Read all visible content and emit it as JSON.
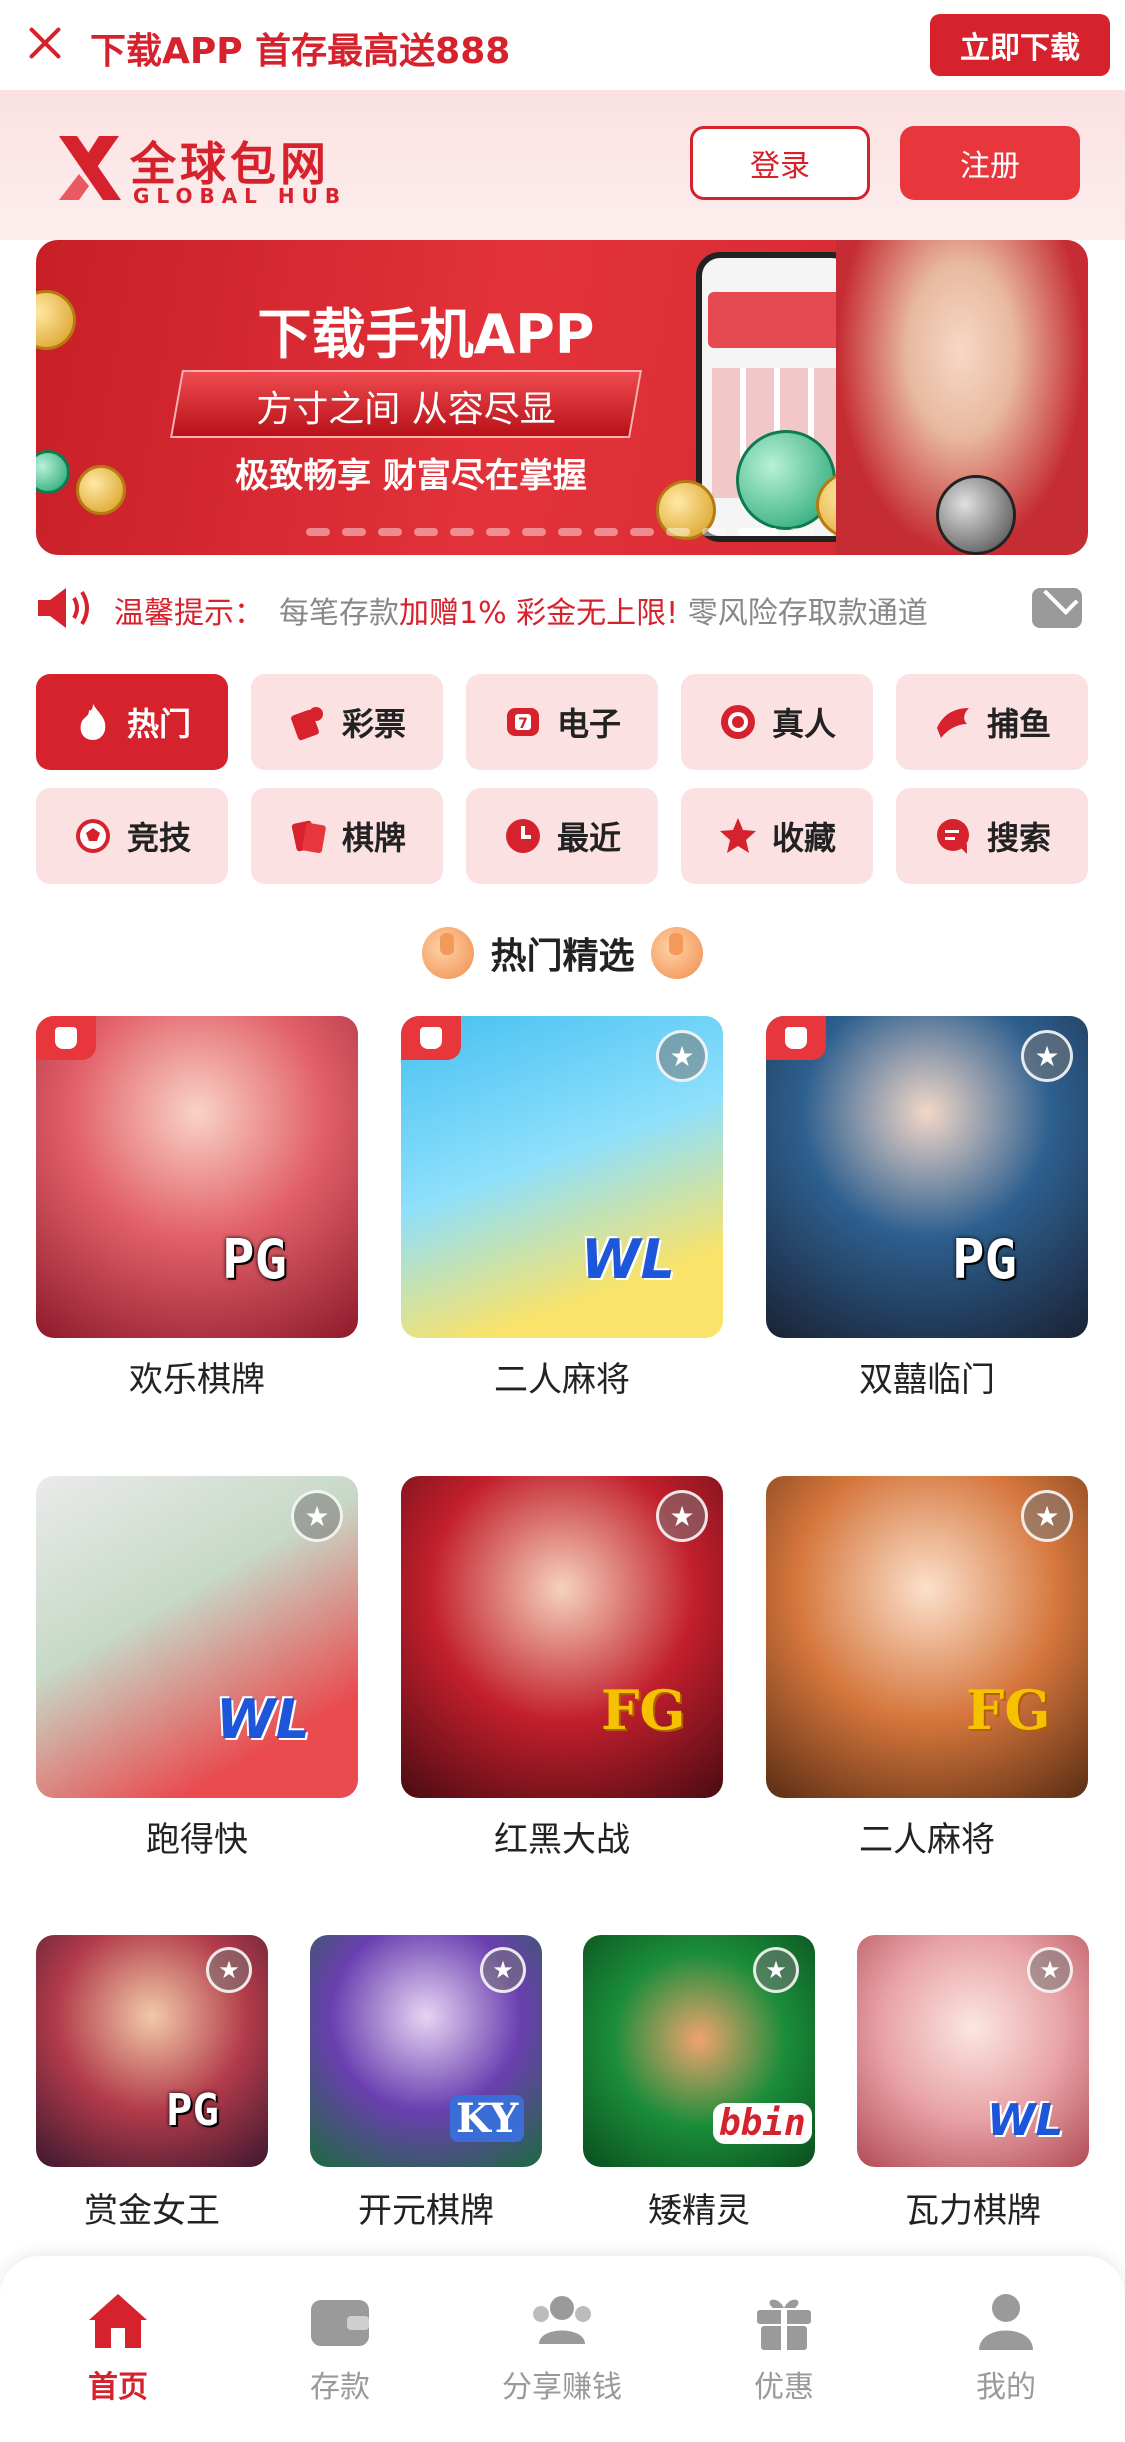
{
  "top_banner": {
    "promo_text": "下载APP 首存最高送888",
    "download_button": "立即下载"
  },
  "header": {
    "brand_name": "全球包网",
    "brand_sub": "GLOBAL HUB",
    "login_button": "登录",
    "register_button": "注册"
  },
  "hero": {
    "headline": "下载手机APP",
    "ribbon_text": "方寸之间 从容尽显",
    "tagline": "极致畅享 财富尽在掌握",
    "slide_count": 14,
    "active_slide": 13
  },
  "notice": {
    "label": "温馨提示：",
    "message_prefix": "每笔存款",
    "message_highlight": "加赠1% 彩金无上限!",
    "message_suffix": "  零风险存取款通道"
  },
  "categories": [
    {
      "label": "热门",
      "icon": "flame-icon",
      "active": true
    },
    {
      "label": "彩票",
      "icon": "lottery-icon",
      "active": false
    },
    {
      "label": "电子",
      "icon": "slot-icon",
      "active": false
    },
    {
      "label": "真人",
      "icon": "chip-icon",
      "active": false
    },
    {
      "label": "捕鱼",
      "icon": "fish-icon",
      "active": false
    },
    {
      "label": "竞技",
      "icon": "soccer-icon",
      "active": false
    },
    {
      "label": "棋牌",
      "icon": "cards-icon",
      "active": false
    },
    {
      "label": "最近",
      "icon": "clock-icon",
      "active": false
    },
    {
      "label": "收藏",
      "icon": "star-icon",
      "active": false
    },
    {
      "label": "搜索",
      "icon": "search-icon",
      "active": false
    }
  ],
  "section_title": "热门精选",
  "games": [
    {
      "name": "欢乐棋牌",
      "provider": "PG",
      "hot": true,
      "favorite_icon": false
    },
    {
      "name": "二人麻将",
      "provider": "WL",
      "hot": true,
      "favorite_icon": true
    },
    {
      "name": "双囍临门",
      "provider": "PG",
      "hot": true,
      "favorite_icon": true
    },
    {
      "name": "跑得快",
      "provider": "WL",
      "hot": false,
      "favorite_icon": true
    },
    {
      "name": "红黑大战",
      "provider": "FG",
      "hot": false,
      "favorite_icon": true
    },
    {
      "name": "二人麻将",
      "provider": "FG",
      "hot": false,
      "favorite_icon": true
    },
    {
      "name": "赏金女王",
      "provider": "PG",
      "hot": false,
      "favorite_icon": true
    },
    {
      "name": "开元棋牌",
      "provider": "KY",
      "hot": false,
      "favorite_icon": true
    },
    {
      "name": "矮精灵",
      "provider": "bbin",
      "hot": false,
      "favorite_icon": true
    },
    {
      "name": "瓦力棋牌",
      "provider": "WL",
      "hot": false,
      "favorite_icon": true
    }
  ],
  "tabbar": [
    {
      "label": "首页",
      "icon": "home-icon",
      "active": true
    },
    {
      "label": "存款",
      "icon": "wallet-icon",
      "active": false
    },
    {
      "label": "分享赚钱",
      "icon": "share-users-icon",
      "active": false
    },
    {
      "label": "优惠",
      "icon": "gift-icon",
      "active": false
    },
    {
      "label": "我的",
      "icon": "user-icon",
      "active": false
    }
  ],
  "colors": {
    "brand_red": "#d6222c",
    "light_pink": "#fbe1e1",
    "gray_text": "#888888"
  }
}
